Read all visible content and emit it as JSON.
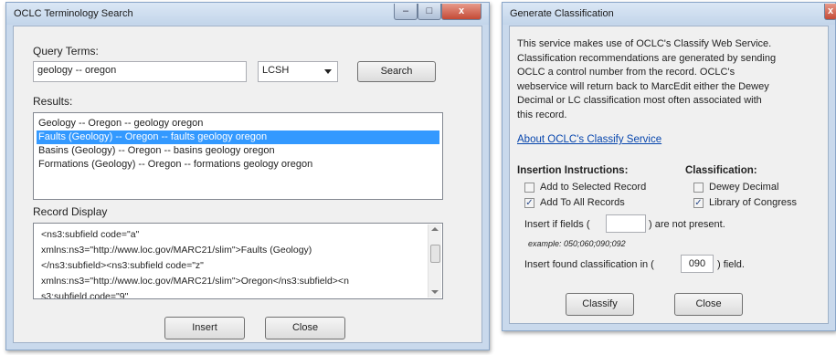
{
  "search_window": {
    "title": "OCLC Terminology Search",
    "controls": {
      "minimize": "–",
      "maximize": "□",
      "close": "x"
    },
    "query_label": "Query Terms:",
    "query_value": "geology -- oregon",
    "vocab_select": "LCSH",
    "search_button": "Search",
    "results_label": "Results:",
    "results": [
      "Geology -- Oregon -- geology oregon",
      "Faults (Geology) -- Oregon -- faults geology oregon",
      "Basins (Geology) -- Oregon -- basins geology oregon",
      "Formations (Geology) -- Oregon -- formations geology oregon"
    ],
    "selected_result_index": 1,
    "record_label": "Record Display",
    "record_lines": [
      "<ns3:subfield code=\"a\"",
      "xmlns:ns3=\"http://www.loc.gov/MARC21/slim\">Faults (Geology)",
      "</ns3:subfield><ns3:subfield code=\"z\"",
      "xmlns:ns3=\"http://www.loc.gov/MARC21/slim\">Oregon</ns3:subfield><n",
      "s3:subfield code=\"9\""
    ],
    "insert_button": "Insert",
    "close_button": "Close"
  },
  "classify_window": {
    "title": "Generate Classification",
    "close_glyph": "x",
    "description_lines": [
      "This service makes use of OCLC's Classify Web Service.",
      "Classification recommendations are generated by sending",
      "OCLC a control number from the record.  OCLC's",
      "webservice will return back to MarcEdit either the Dewey",
      "Decimal or LC classification most often associated with",
      "this record."
    ],
    "about_link": "About OCLC's Classify Service",
    "insertion_heading": "Insertion Instructions:",
    "classification_heading": "Classification:",
    "add_selected": {
      "label": "Add to Selected Record",
      "checked": false
    },
    "add_all": {
      "label": "Add To All Records",
      "checked": true
    },
    "dewey": {
      "label": "Dewey Decimal",
      "checked": false
    },
    "loc": {
      "label": "Library of Congress",
      "checked": true
    },
    "insert_if_prefix": "Insert if fields (",
    "insert_if_value": "",
    "insert_if_suffix": ") are not present.",
    "example": "example:  050;060;090;092",
    "found_prefix": "Insert found classification in (",
    "found_value": "090",
    "found_suffix": ") field.",
    "classify_button": "Classify",
    "close_button": "Close"
  },
  "colors": {
    "selection": "#3399ff",
    "link": "#0645ad",
    "close_red": "#c75050"
  }
}
